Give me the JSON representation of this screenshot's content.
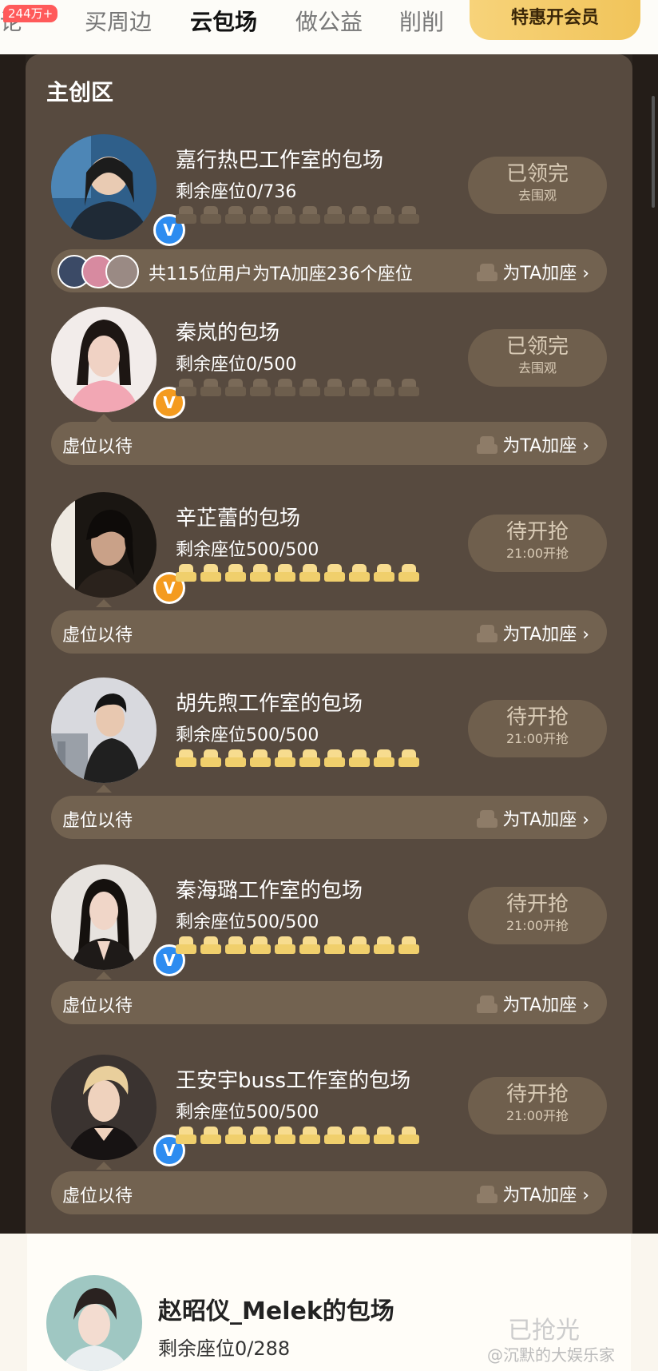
{
  "topbar": {
    "tabs": [
      {
        "label": "评论",
        "badge": "244万+",
        "active": false
      },
      {
        "label": "买周边",
        "active": false
      },
      {
        "label": "云包场",
        "active": true
      },
      {
        "label": "做公益",
        "active": false
      },
      {
        "label": "削削",
        "active": false
      }
    ],
    "vip_button": "特惠开会员"
  },
  "section_title": "主创区",
  "add_seat_label": "为TA加座",
  "cards": [
    {
      "name": "嘉行热巴工作室的包场",
      "seats": "剩余座位0/736",
      "status": "已领完",
      "status_sub": "去围观",
      "verified": "blue",
      "lit": 0,
      "bar_text": "共115位用户为TA加座236个座位"
    },
    {
      "name": "秦岚的包场",
      "seats": "剩余座位0/500",
      "status": "已领完",
      "status_sub": "去围观",
      "verified": "orange",
      "lit": 0,
      "bar_text": "虚位以待"
    },
    {
      "name": "辛芷蕾的包场",
      "seats": "剩余座位500/500",
      "status": "待开抢",
      "status_sub": "21:00开抢",
      "verified": "orange",
      "lit": 10,
      "bar_text": "虚位以待"
    },
    {
      "name": "胡先煦工作室的包场",
      "seats": "剩余座位500/500",
      "status": "待开抢",
      "status_sub": "21:00开抢",
      "verified": "none",
      "lit": 10,
      "bar_text": "虚位以待"
    },
    {
      "name": "秦海璐工作室的包场",
      "seats": "剩余座位500/500",
      "status": "待开抢",
      "status_sub": "21:00开抢",
      "verified": "blue",
      "lit": 10,
      "bar_text": "虚位以待"
    },
    {
      "name": "王安宇buss工作室的包场",
      "seats": "剩余座位500/500",
      "status": "待开抢",
      "status_sub": "21:00开抢",
      "verified": "blue",
      "lit": 10,
      "bar_text": "虚位以待"
    }
  ],
  "bottom_card": {
    "name": "赵昭仪_Melek的包场",
    "seats": "剩余座位0/288",
    "status": "已抢光"
  },
  "watermark": "@沉默的大娱乐家",
  "colors": {
    "panel": "#574a3f",
    "accent_gold": "#f1c45a",
    "seat_on": "#f0cf6c",
    "seat_off": "#6d5e4d"
  }
}
